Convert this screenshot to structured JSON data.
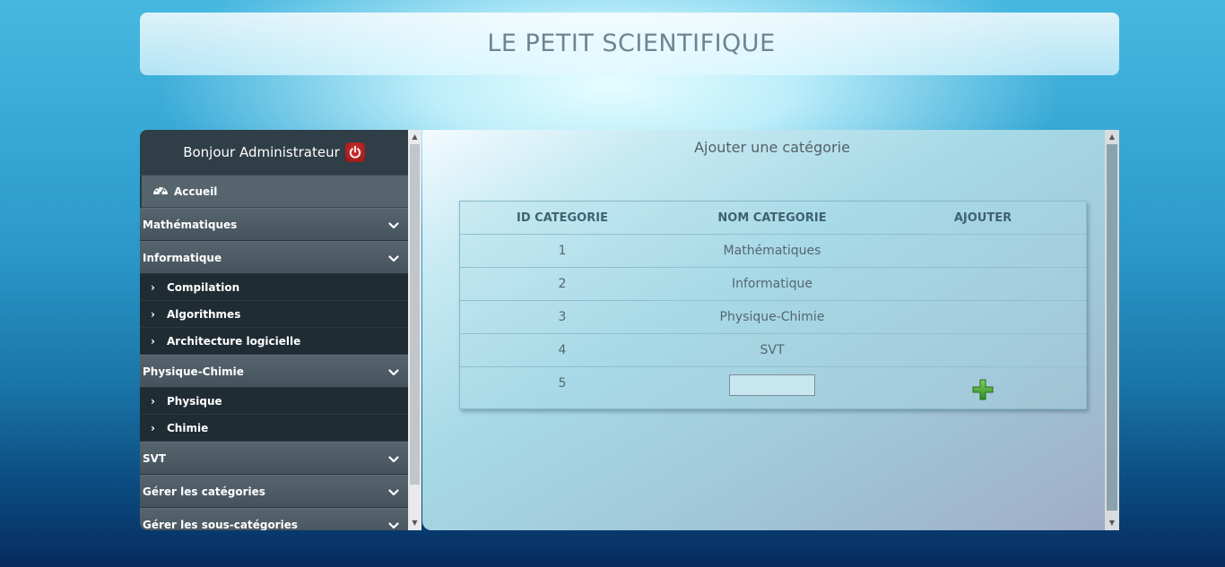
{
  "header": {
    "title": "LE PETIT SCIENTIFIQUE"
  },
  "sidebar": {
    "greeting": "Bonjour Administrateur",
    "home_label": "Accueil",
    "sections": [
      {
        "label": "Mathématiques",
        "expanded": false,
        "children": []
      },
      {
        "label": "Informatique",
        "expanded": true,
        "children": [
          "Compilation",
          "Algorithmes",
          "Architecture logicielle"
        ]
      },
      {
        "label": "Physique-Chimie",
        "expanded": true,
        "children": [
          "Physique",
          "Chimie"
        ]
      },
      {
        "label": "SVT",
        "expanded": false,
        "children": []
      },
      {
        "label": "Gérer les catégories",
        "expanded": false,
        "children": []
      },
      {
        "label": "Gérer les sous-catégories",
        "expanded": false,
        "children": []
      }
    ]
  },
  "main": {
    "title": "Ajouter une catégorie",
    "table": {
      "headers": [
        "ID CATEGORIE",
        "NOM CATEGORIE",
        "AJOUTER"
      ],
      "rows": [
        {
          "id": "1",
          "name": "Mathématiques"
        },
        {
          "id": "2",
          "name": "Informatique"
        },
        {
          "id": "3",
          "name": "Physique-Chimie"
        },
        {
          "id": "4",
          "name": "SVT"
        }
      ],
      "new_row": {
        "id": "5",
        "name_value": ""
      }
    }
  },
  "icons": {
    "power": "power-icon",
    "home": "dashboard-icon",
    "add": "plus-icon",
    "chevron": "chevron-down-icon",
    "sub_arrow": "chevron-right-icon"
  },
  "colors": {
    "power_button": "#b52222",
    "add_icon": "#3f9a2f",
    "sidebar_bg": "#2a3a44"
  }
}
